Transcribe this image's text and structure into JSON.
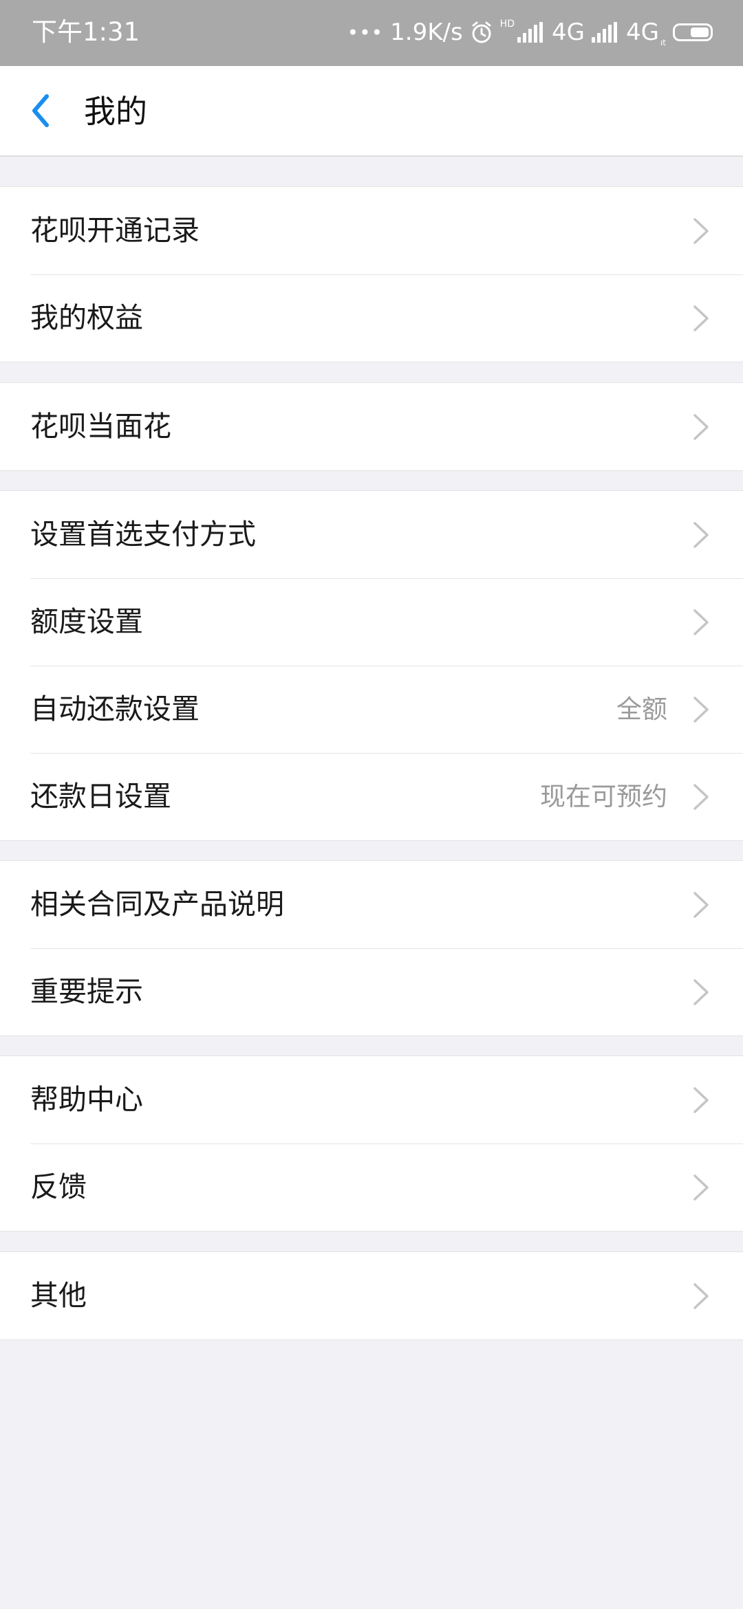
{
  "status_bar": {
    "time": "下午1:31",
    "net_speed": "1.9K/s",
    "hd": "HD",
    "signal1": "4G",
    "signal2": "4G",
    "signal2_sub": "ıt"
  },
  "header": {
    "title": "我的"
  },
  "groups": [
    {
      "items": [
        {
          "label": "花呗开通记录",
          "value": ""
        },
        {
          "label": "我的权益",
          "value": ""
        }
      ]
    },
    {
      "items": [
        {
          "label": "花呗当面花",
          "value": ""
        }
      ]
    },
    {
      "items": [
        {
          "label": "设置首选支付方式",
          "value": ""
        },
        {
          "label": "额度设置",
          "value": ""
        },
        {
          "label": "自动还款设置",
          "value": "全额"
        },
        {
          "label": "还款日设置",
          "value": "现在可预约"
        }
      ]
    },
    {
      "items": [
        {
          "label": "相关合同及产品说明",
          "value": ""
        },
        {
          "label": "重要提示",
          "value": ""
        }
      ]
    },
    {
      "items": [
        {
          "label": "帮助中心",
          "value": ""
        },
        {
          "label": "反馈",
          "value": ""
        }
      ]
    },
    {
      "items": [
        {
          "label": "其他",
          "value": ""
        }
      ]
    }
  ],
  "colors": {
    "accent": "#1a8ef0",
    "background": "#f2f2f6",
    "status_bar": "#a9a9a9"
  },
  "icons": {
    "back": "chevron-left-icon",
    "row": "chevron-right-icon"
  }
}
